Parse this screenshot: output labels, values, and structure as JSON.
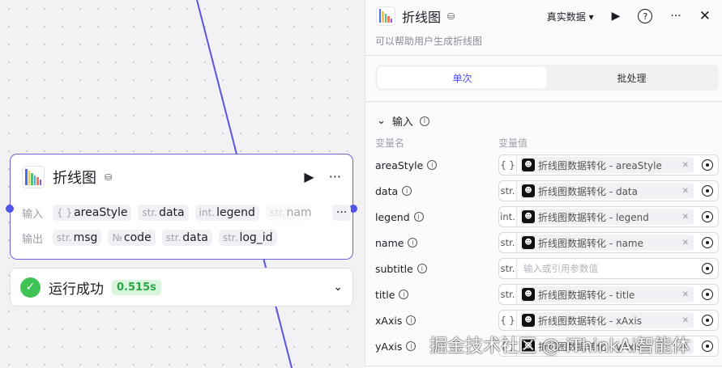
{
  "node": {
    "title": "折线图",
    "input_label": "输入",
    "output_label": "输出",
    "inputs": [
      {
        "type": "{ }",
        "name": "areaStyle"
      },
      {
        "type": "str.",
        "name": "data"
      },
      {
        "type": "int.",
        "name": "legend"
      },
      {
        "type": "str.",
        "name": "nam"
      }
    ],
    "more": "···",
    "outputs": [
      {
        "type": "str.",
        "name": "msg"
      },
      {
        "type": "№",
        "name": "code"
      },
      {
        "type": "str.",
        "name": "data"
      },
      {
        "type": "str.",
        "name": "log_id"
      }
    ]
  },
  "status": {
    "text": "运行成功",
    "time": "0.515s"
  },
  "panel": {
    "title": "折线图",
    "data_mode": "真实数据",
    "description": "可以帮助用户生成折线图",
    "tabs": [
      "单次",
      "批处理"
    ],
    "section": "输入",
    "col_name": "变量名",
    "col_value": "变量值",
    "rows": [
      {
        "name": "areaStyle",
        "type": "{ }",
        "ref": "折线图数据转化 - areaStyle"
      },
      {
        "name": "data",
        "type": "str.",
        "ref": "折线图数据转化 - data"
      },
      {
        "name": "legend",
        "type": "int.",
        "ref": "折线图数据转化 - legend"
      },
      {
        "name": "name",
        "type": "str.",
        "ref": "折线图数据转化 - name"
      },
      {
        "name": "subtitle",
        "type": "str.",
        "placeholder": "输入或引用参数值"
      },
      {
        "name": "title",
        "type": "str.",
        "ref": "折线图数据转化 - title"
      },
      {
        "name": "xAxis",
        "type": "{ }",
        "ref": "折线图数据转化 - xAxis"
      },
      {
        "name": "yAxis",
        "type": "{ }",
        "ref": "折线图数据转化 - yAxis"
      }
    ]
  },
  "watermark": "掘金技术社区 @ iThinkAi智能体",
  "colors": {
    "accent": "#4d53e8",
    "success": "#3ec254"
  }
}
